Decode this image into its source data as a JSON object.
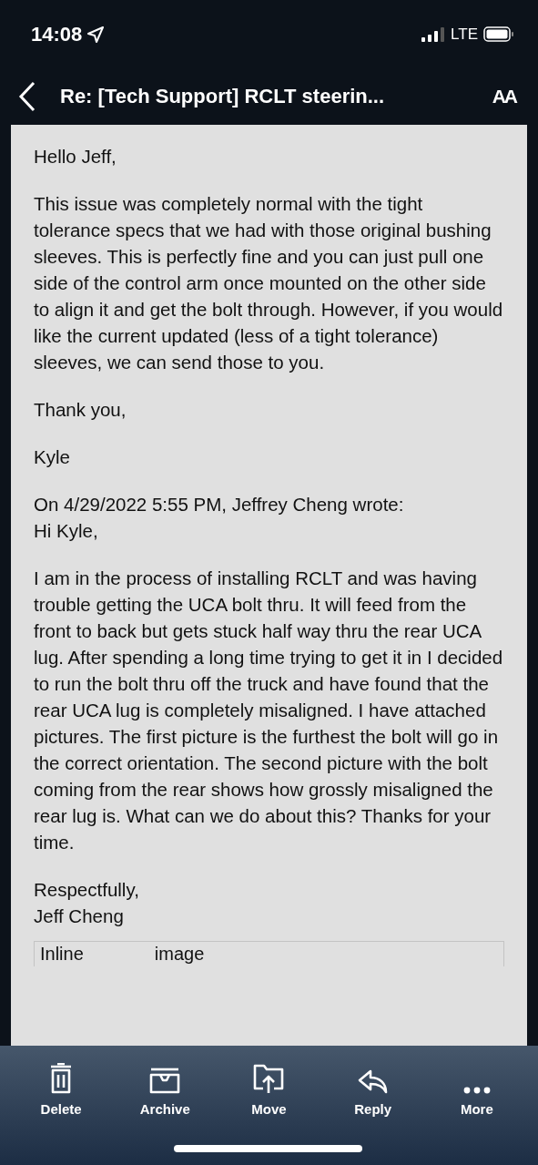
{
  "status_bar": {
    "time": "14:08",
    "network": "LTE"
  },
  "header": {
    "title": "Re: [Tech Support] RCLT steerin...",
    "text_size_button": "AA"
  },
  "email": {
    "blocks": [
      {
        "lines": [
          "Hello Jeff,"
        ]
      },
      {
        "lines": [
          "This issue was completely normal with the tight tolerance specs that we had with those original bushing sleeves. This is perfectly fine and you can just pull one side of the control arm once mounted on the other side to align it and get the bolt through. However, if you would like the current updated (less of a tight tolerance) sleeves, we can send those to you."
        ]
      },
      {
        "lines": [
          "Thank you,"
        ]
      },
      {
        "lines": [
          "Kyle"
        ]
      },
      {
        "lines": [
          "On 4/29/2022 5:55 PM, Jeffrey Cheng wrote:",
          "Hi Kyle,"
        ]
      },
      {
        "lines": [
          "I am in the process of installing RCLT and was having trouble getting the UCA bolt thru. It will feed from the front to back but gets stuck half way thru the rear UCA lug. After spending a long time trying to get it in I decided to run the bolt thru off the truck and have found that the rear UCA lug is completely misaligned. I have attached pictures. The first picture is the furthest the bolt will go in the correct orientation. The second picture with the bolt coming from the rear shows how grossly misaligned the rear lug is. What can we do about this? Thanks for your time."
        ]
      },
      {
        "lines": [
          "Respectfully,",
          "Jeff Cheng"
        ]
      }
    ],
    "inline_image": [
      "Inline",
      "image"
    ]
  },
  "toolbar": [
    {
      "kind": "delete",
      "label": "Delete"
    },
    {
      "kind": "archive",
      "label": "Archive"
    },
    {
      "kind": "move",
      "label": "Move"
    },
    {
      "kind": "reply",
      "label": "Reply"
    },
    {
      "kind": "more",
      "label": "More"
    }
  ]
}
